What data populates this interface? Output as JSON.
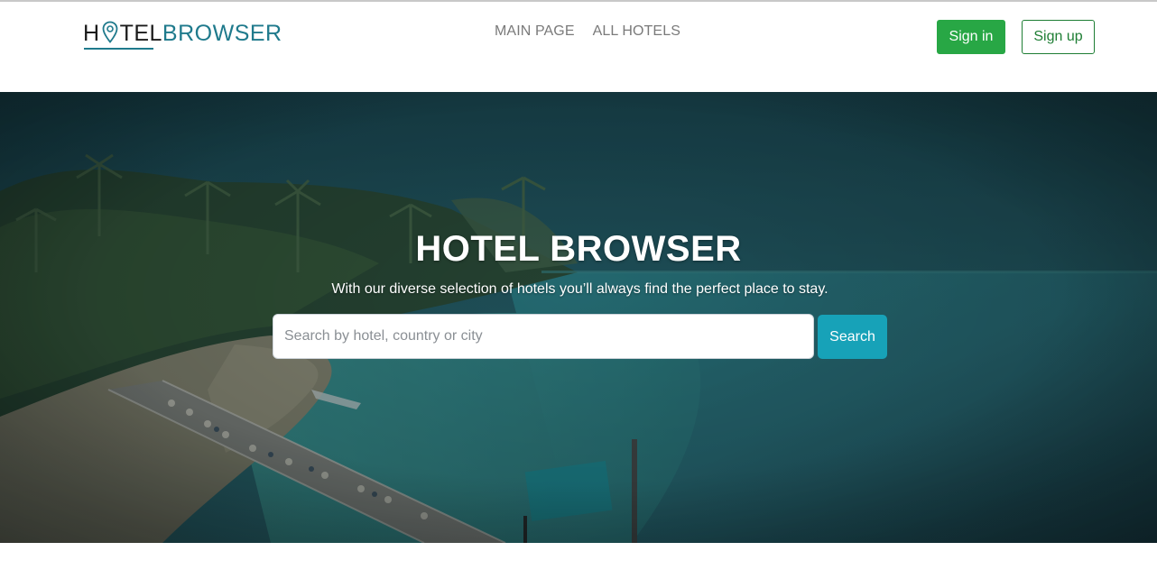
{
  "brand": {
    "logo_part1": "H",
    "logo_part2": "TEL",
    "logo_part3": "BROWSER",
    "colors": {
      "dark": "#1a1a1a",
      "teal": "#1f7a8c"
    }
  },
  "nav": {
    "items": [
      {
        "label": "MAIN PAGE"
      },
      {
        "label": "ALL HOTELS"
      }
    ]
  },
  "auth": {
    "signin_label": "Sign in",
    "signup_label": "Sign up",
    "colors": {
      "signin_bg": "#28a745",
      "signup_border": "#1e7e34"
    }
  },
  "hero": {
    "title": "HOTEL BROWSER",
    "subtitle": "With our diverse selection of hotels you’ll always find the perfect place to stay.",
    "search": {
      "placeholder": "Search by hotel, country or city",
      "value": "",
      "button_label": "Search",
      "button_color": "#17a2b8"
    }
  }
}
